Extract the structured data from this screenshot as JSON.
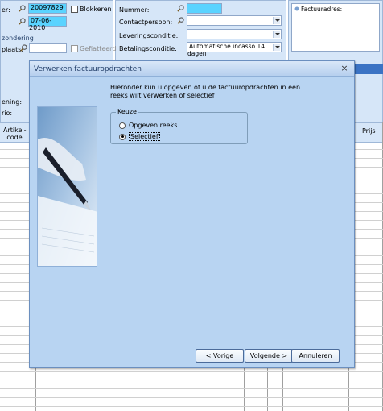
{
  "form": {
    "f1_label": "er:",
    "f1_value": "20097829",
    "blokkeren_label": "Blokkeren",
    "f2_label": "",
    "f2_value": "07-06-2010",
    "zondering_label": "zondering",
    "plaats_label": "plaats:",
    "gefiatteerd_label": "Gefiatteerd",
    "ening_label": "ening:",
    "rio_label": "rio:",
    "nummer_label": "Nummer:",
    "contactpersoon_label": "Contactpersoon:",
    "leveringsconditie_label": "Leveringsconditie:",
    "betalingsconditie_label": "Betalingsconditie:",
    "betalingsconditie_value": "Automatische incasso 14 dagen",
    "factuuradres_label": "Factuuradres:"
  },
  "table": {
    "col_artikel": "Artikel-\ncode",
    "col_prijs": "Prijs"
  },
  "dialog": {
    "title": "Verwerken factuuropdrachten",
    "close_glyph": "×",
    "intro": "Hieronder kun u opgeven of u de factuuropdrachten in een reeks wilt verwerken of selectief",
    "group_label": "Keuze",
    "option_reeks": "Opgeven reeks",
    "option_selectief": "Selectief",
    "selected": "Selectief",
    "btn_back": "< Vorige",
    "btn_next": "Volgende >",
    "btn_cancel": "Annuleren"
  },
  "colors": {
    "dialog_bg": "#b8d4f2",
    "panel_bg": "#d6e6f8",
    "highlight_field": "#5ad3ff"
  }
}
